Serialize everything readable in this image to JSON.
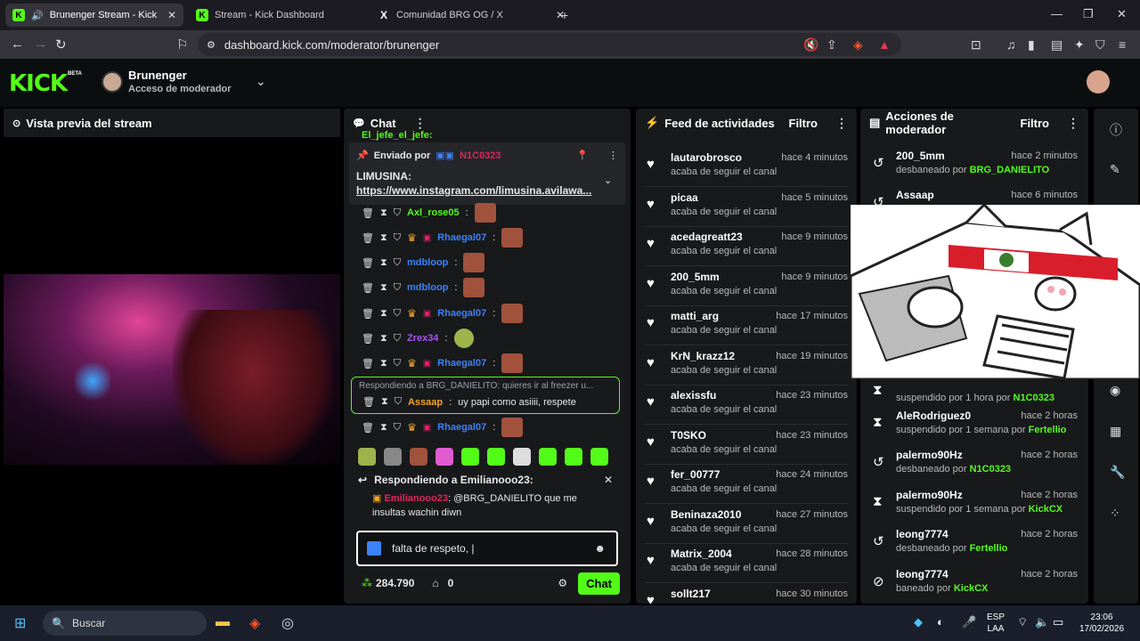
{
  "browser": {
    "tabs": [
      {
        "label": "Brunenger Stream - Kick Dash",
        "icon": "K"
      },
      {
        "label": "Stream - Kick Dashboard",
        "icon": "K"
      },
      {
        "label": "Comunidad BRG OG / X",
        "icon": "X"
      }
    ],
    "url": "dashboard.kick.com/moderator/brunenger"
  },
  "header": {
    "logo": "KICK",
    "beta": "BETA",
    "channel_name": "Brunenger",
    "channel_sub": "Acceso de moderador"
  },
  "preview": {
    "title": "Vista previa del stream"
  },
  "chat": {
    "title": "Chat",
    "top_cut_user": "El_jefe_el_jefe:",
    "pinned": {
      "sent_by": "Enviado por",
      "sender": "N1C0323",
      "title": "LIMUSINA:",
      "link": "https://www.instagram.com/limusina.avilawa..."
    },
    "messages": [
      {
        "user": "Axl_rose05",
        "color": "#53fc18"
      },
      {
        "user": "Rhaegal07",
        "color": "#3b82f6"
      },
      {
        "user": "mdbloop",
        "color": "#3b82f6"
      },
      {
        "user": "mdbloop",
        "color": "#3b82f6"
      },
      {
        "user": "Rhaegal07",
        "color": "#3b82f6"
      },
      {
        "user": "Zrex34",
        "color": "#a855f7"
      },
      {
        "user": "Rhaegal07",
        "color": "#3b82f6"
      }
    ],
    "reply_context": "Respondiendo a BRG_DANIELITO: quieres ir al freezer u...",
    "reply_message": {
      "user": "Assaap",
      "text": "uy papi como asiiii, respete"
    },
    "last_message": {
      "user": "Rhaegal07"
    },
    "reply_box": {
      "title": "Respondiendo a Emilianooo23:",
      "user": "Emilianooo23",
      "text": "@BRG_DANIELITO que me insultas wachin diwn"
    },
    "input_value": "falta de respeto, |",
    "points": "284.790",
    "store_count": "0",
    "send_label": "Chat"
  },
  "activity": {
    "title": "Feed de actividades",
    "filter": "Filtro",
    "items": [
      {
        "name": "lautarobrosco",
        "time": "hace 4 minutos",
        "sub": "acaba de seguir el canal"
      },
      {
        "name": "picaa",
        "time": "hace 5 minutos",
        "sub": "acaba de seguir el canal"
      },
      {
        "name": "acedagreatt23",
        "time": "hace 9 minutos",
        "sub": "acaba de seguir el canal"
      },
      {
        "name": "200_5mm",
        "time": "hace 9 minutos",
        "sub": "acaba de seguir el canal"
      },
      {
        "name": "matti_arg",
        "time": "hace 17 minutos",
        "sub": "acaba de seguir el canal"
      },
      {
        "name": "KrN_krazz12",
        "time": "hace 19 minutos",
        "sub": "acaba de seguir el canal"
      },
      {
        "name": "alexissfu",
        "time": "hace 23 minutos",
        "sub": "acaba de seguir el canal"
      },
      {
        "name": "T0SKO",
        "time": "hace 23 minutos",
        "sub": "acaba de seguir el canal"
      },
      {
        "name": "fer_00777",
        "time": "hace 24 minutos",
        "sub": "acaba de seguir el canal"
      },
      {
        "name": "Beninaza2010",
        "time": "hace 27 minutos",
        "sub": "acaba de seguir el canal"
      },
      {
        "name": "Matrix_2004",
        "time": "hace 28 minutos",
        "sub": "acaba de seguir el canal"
      },
      {
        "name": "sollt217",
        "time": "hace 30 minutos",
        "sub": ""
      }
    ]
  },
  "mod": {
    "title": "Acciones de moderador",
    "filter": "Filtro",
    "items": [
      {
        "name": "200_5mm",
        "time": "hace 2 minutos",
        "action": "desbaneado por",
        "by": "BRG_DANIELITO",
        "icon": "↺"
      },
      {
        "name": "Assaap",
        "time": "hace 6 minutos",
        "action": "",
        "by": "",
        "icon": "↺"
      },
      {
        "name": "",
        "time": "",
        "action": "suspendido por 1 hora por",
        "by": "N1C0323",
        "icon": "⧗"
      },
      {
        "name": "AleRodriguez0",
        "time": "hace 2 horas",
        "action": "suspendido por 1 semana por",
        "by": "Fertellio",
        "icon": "⧗"
      },
      {
        "name": "palermo90Hz",
        "time": "hace 2 horas",
        "action": "desbaneado por",
        "by": "N1C0323",
        "icon": "↺"
      },
      {
        "name": "palermo90Hz",
        "time": "hace 2 horas",
        "action": "suspendido por 1 semana por",
        "by": "KickCX",
        "icon": "⧗"
      },
      {
        "name": "leong7774",
        "time": "hace 2 horas",
        "action": "desbaneado por",
        "by": "Fertellio",
        "icon": "↺"
      },
      {
        "name": "leong7774",
        "time": "hace 2 horas",
        "action": "baneado por",
        "by": "KickCX",
        "icon": "⊘"
      }
    ]
  },
  "taskbar": {
    "search": "Buscar",
    "lang": "ESP",
    "lang2": "LAA",
    "time": "23:06",
    "date": "17/02/2026"
  }
}
